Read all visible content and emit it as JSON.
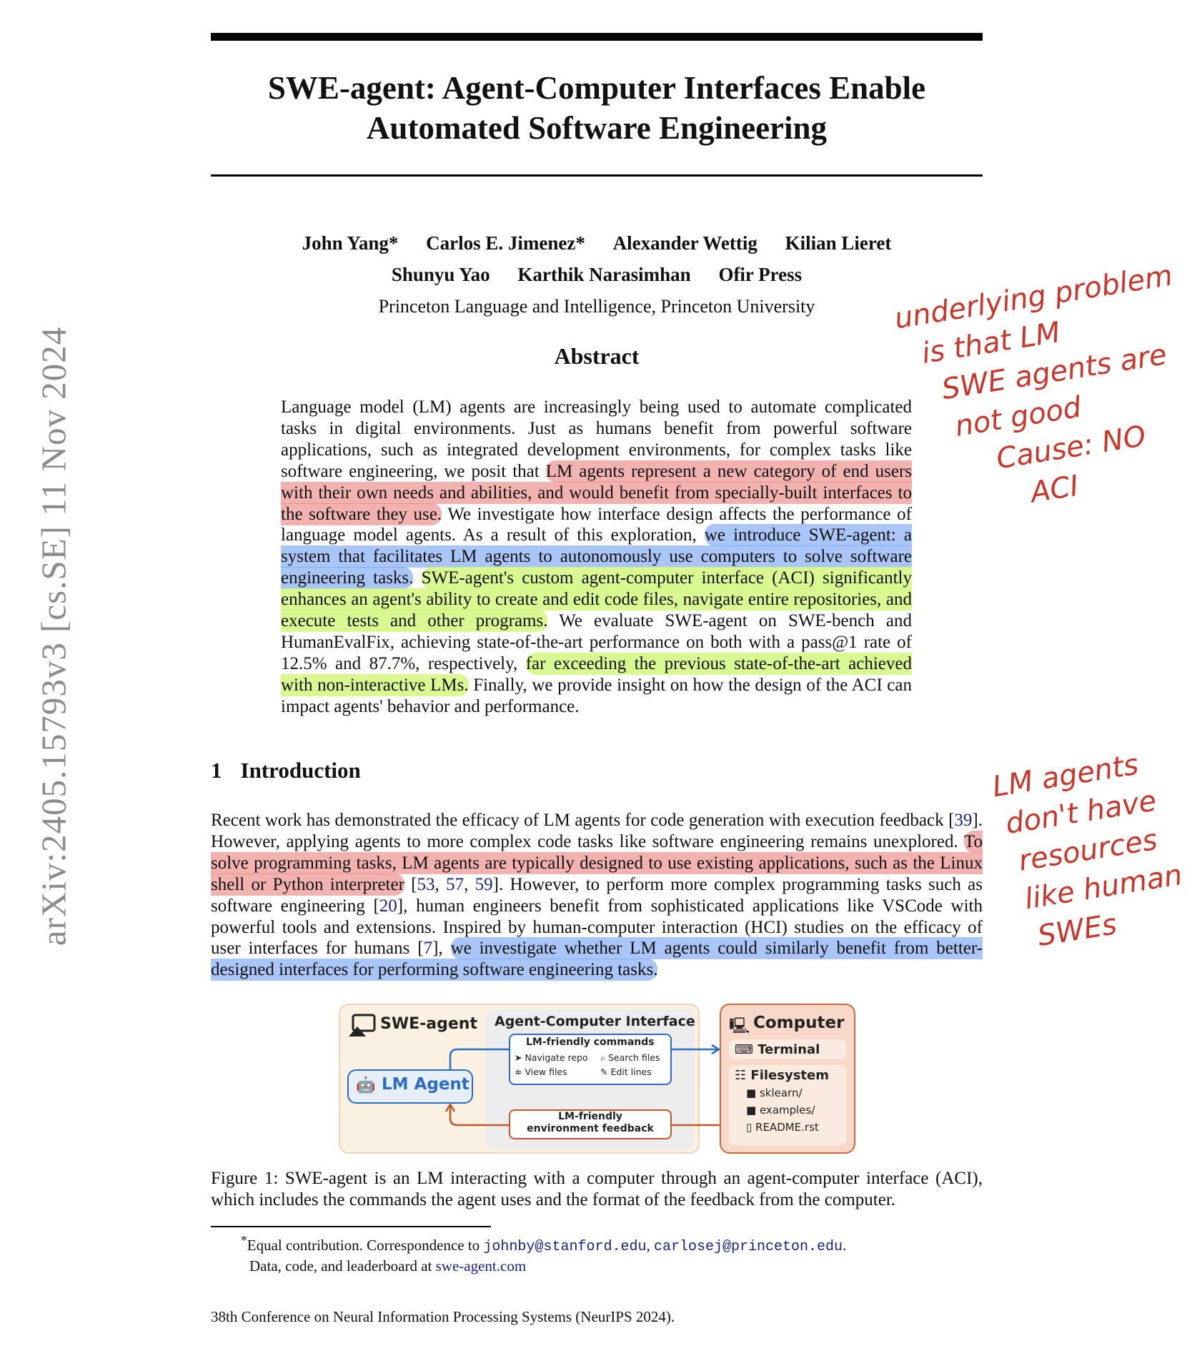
{
  "sidebar": {
    "arxiv_id": "arXiv:2405.15793v3  [cs.SE]  11 Nov 2024"
  },
  "paper": {
    "title": "SWE-agent: Agent-Computer Interfaces Enable Automated Software Engineering",
    "authors_line1": [
      "John Yang*",
      "Carlos E. Jimenez*",
      "Alexander Wettig",
      "Kilian Lieret"
    ],
    "authors_line2": [
      "Shunyu Yao",
      "Karthik Narasimhan",
      "Ofir Press"
    ],
    "affiliation": "Princeton Language and Intelligence, Princeton University",
    "abstract_heading": "Abstract",
    "abstract": {
      "p1": "Language model (LM) agents are increasingly being used to automate complicated tasks in digital environments. Just as humans benefit from powerful software applications, such as integrated development environments, for complex tasks like software engineering, we posit that",
      "hl1": "LM agents represent a new category of end users with their own needs and abilities, and would benefit from specially-built interfaces to the software they use.",
      "p2": "We investigate how interface design affects the performance of language model agents. As a result of this exploration,",
      "hl2": "we introduce SWE-agent: a system that facilitates LM agents to autonomously use computers to solve software engineering tasks.",
      "hl3": "SWE-agent's custom agent-computer interface (ACI) significantly enhances an agent's ability to create and edit code files, navigate entire repositories, and execute tests and other programs.",
      "p3": "We evaluate SWE-agent on SWE-bench and HumanEvalFix, achieving state-of-the-art performance on both with a pass@1 rate of 12.5% and 87.7%, respectively,",
      "hl4": "far exceeding the previous state-of-the-art achieved with non-interactive LMs.",
      "p4": "Finally, we provide insight on how the design of the ACI can impact agents' behavior and performance."
    },
    "section_number": "1",
    "section_title": "Introduction",
    "intro": {
      "p1": "Recent work has demonstrated the efficacy of LM agents for code generation with execution feedback [",
      "c39": "39",
      "p2": "]. However, applying agents to more complex code tasks like software engineering remains unexplored.",
      "hl1": "To solve programming tasks, LM agents are typically designed to use existing applications, such as the Linux shell or Python interpreter",
      "p3": " [",
      "c53": "53",
      "c57": "57",
      "c59": "59",
      "p4": "]. However, to perform more complex programming tasks such as software engineering [",
      "c20": "20",
      "p5": "], human engineers benefit from sophisticated applications like VSCode with powerful tools and extensions. Inspired by human-computer interaction (HCI) studies on the efficacy of user interfaces for humans [",
      "c7": "7",
      "p6": "],",
      "hl2": "we investigate whether LM agents could similarly benefit from better-designed interfaces for performing software engineering tasks."
    },
    "figure": {
      "swe_agent": "SWE-agent",
      "aci_title": "Agent-Computer Interface",
      "lm_agent": "LM Agent",
      "commands_title": "LM-friendly commands",
      "cmd1": "Navigate repo",
      "cmd2": "Search files",
      "cmd3": "View files",
      "cmd4": "Edit lines",
      "feedback_line1": "LM-friendly",
      "feedback_line2": "environment feedback",
      "computer": "Computer",
      "terminal": "Terminal",
      "filesystem": "Filesystem",
      "files": [
        "sklearn/",
        "examples/",
        "README.rst"
      ]
    },
    "caption": "Figure 1: SWE-agent is an LM interacting with a computer through an agent-computer interface (ACI), which includes the commands the agent uses and the format of the feedback from the computer.",
    "footnote": {
      "text1": "Equal contribution. Correspondence to",
      "email1": "johnby@stanford.edu",
      "email2": "carlosej@princeton.edu",
      "text2": "Data, code, and leaderboard at",
      "link": "swe-agent.com"
    },
    "conference": "38th Conference on Neural Information Processing Systems (NeurIPS 2024)."
  },
  "annotations": {
    "note1": [
      "underlying problem",
      "is that LM",
      "SWE agents are",
      "not good",
      "Cause: NO",
      "ACI"
    ],
    "note2": [
      "LM agents",
      "don't have",
      "resources",
      "like human",
      "SWEs"
    ],
    "highlight_colors": {
      "red": "#e7756f",
      "blue": "#6496f0",
      "green": "#cdf56e"
    },
    "ink_color": "#c7372c"
  }
}
